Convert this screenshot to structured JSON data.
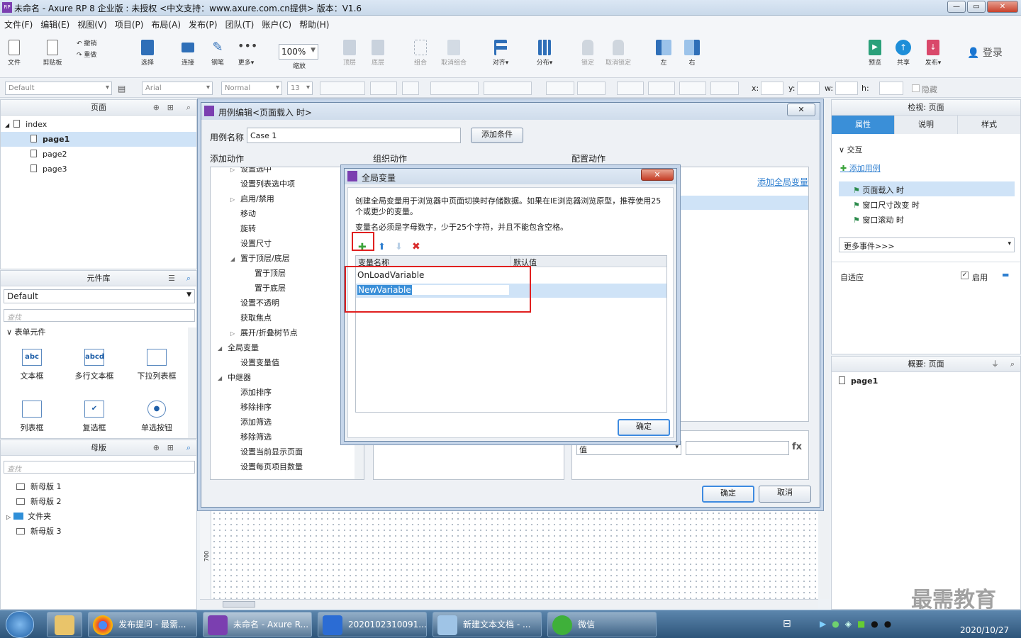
{
  "window": {
    "title": "未命名 - Axure RP 8 企业版 : 未授权     <中文支持：www.axure.com.cn提供> 版本：V1.6",
    "app_icon": "RP"
  },
  "menu": [
    "文件(F)",
    "编辑(E)",
    "视图(V)",
    "项目(P)",
    "布局(A)",
    "发布(P)",
    "团队(T)",
    "账户(C)",
    "帮助(H)"
  ],
  "toolbar": {
    "file": "文件",
    "clipboard": "剪贴板",
    "undo": "撤销",
    "redo": "重做",
    "select": "选择",
    "connect": "连接",
    "pen": "钢笔",
    "more": "更多▾",
    "zoom_value": "100%",
    "zoom": "缩放",
    "top": "顶层",
    "bottom": "底层",
    "group": "组合",
    "ungroup": "取消组合",
    "align": "对齐▾",
    "distribute": "分布▾",
    "lock": "锁定",
    "unlock": "取消锁定",
    "left": "左",
    "right": "右",
    "preview": "预览",
    "share": "共享",
    "publish": "发布▾",
    "login": "登录"
  },
  "format": {
    "style": "Default",
    "font": "Arial",
    "weight": "Normal",
    "size": "13",
    "x": "x:",
    "y": "y:",
    "w": "w:",
    "h": "h:",
    "hide": "隐藏"
  },
  "pages_panel": {
    "title": "页面",
    "root": "index",
    "pages": [
      "page1",
      "page2",
      "page3"
    ]
  },
  "library_panel": {
    "title": "元件库",
    "library": "Default",
    "search": "查找",
    "section": "表单元件",
    "widgets": [
      {
        "label": "文本框",
        "icon": "abc"
      },
      {
        "label": "多行文本框",
        "icon": "abcd"
      },
      {
        "label": "下拉列表框",
        "icon": ""
      },
      {
        "label": "列表框",
        "icon": ""
      },
      {
        "label": "复选框",
        "icon": "✔"
      },
      {
        "label": "单选按钮",
        "icon": "●"
      }
    ]
  },
  "masters_panel": {
    "title": "母版",
    "search": "查找",
    "items": [
      "新母版 1",
      "新母版 2",
      "文件夹",
      "新母版 3"
    ]
  },
  "case_editor": {
    "title": "用例编辑<页面载入 时>",
    "case_name_label": "用例名称",
    "case_name_value": "Case 1",
    "add_condition": "添加条件",
    "col_add": "添加动作",
    "col_organize": "组织动作",
    "col_configure": "配置动作",
    "add_global_var": "添加全局变量",
    "actions": [
      {
        "label": "设置选中",
        "indent": 2,
        "arrow": "▷"
      },
      {
        "label": "设置列表选中项",
        "indent": 2,
        "arrow": ""
      },
      {
        "label": "启用/禁用",
        "indent": 2,
        "arrow": "▷"
      },
      {
        "label": "移动",
        "indent": 2,
        "arrow": ""
      },
      {
        "label": "旋转",
        "indent": 2,
        "arrow": ""
      },
      {
        "label": "设置尺寸",
        "indent": 2,
        "arrow": ""
      },
      {
        "label": "置于顶层/底层",
        "indent": 2,
        "arrow": "◢"
      },
      {
        "label": "置于顶层",
        "indent": 3,
        "arrow": ""
      },
      {
        "label": "置于底层",
        "indent": 3,
        "arrow": ""
      },
      {
        "label": "设置不透明",
        "indent": 2,
        "arrow": ""
      },
      {
        "label": "获取焦点",
        "indent": 2,
        "arrow": ""
      },
      {
        "label": "展开/折叠树节点",
        "indent": 2,
        "arrow": "▷"
      },
      {
        "label": "全局变量",
        "indent": 1,
        "arrow": "◢"
      },
      {
        "label": "设置变量值",
        "indent": 2,
        "arrow": ""
      },
      {
        "label": "中继器",
        "indent": 1,
        "arrow": "◢"
      },
      {
        "label": "添加排序",
        "indent": 2,
        "arrow": ""
      },
      {
        "label": "移除排序",
        "indent": 2,
        "arrow": ""
      },
      {
        "label": "添加筛选",
        "indent": 2,
        "arrow": ""
      },
      {
        "label": "移除筛选",
        "indent": 2,
        "arrow": ""
      },
      {
        "label": "设置当前显示页面",
        "indent": 2,
        "arrow": ""
      },
      {
        "label": "设置每页项目数量",
        "indent": 2,
        "arrow": ""
      }
    ],
    "value_dropdown": "值",
    "fx": "fx",
    "ok": "确定",
    "cancel": "取消"
  },
  "global_vars": {
    "title": "全局变量",
    "desc1": "创建全局变量用于浏览器中页面切换时存储数据。如果在IE浏览器浏览原型，推荐使用25个或更少的变量。",
    "desc2": "变量名必须是字母数字，少于25个字符，并且不能包含空格。",
    "col_name": "变量名称",
    "col_default": "默认值",
    "rows": [
      "OnLoadVariable",
      "NewVariable"
    ],
    "ok": "确定"
  },
  "inspector": {
    "title": "检视: 页面",
    "tabs": [
      "属性",
      "说明",
      "样式"
    ],
    "interaction": "交互",
    "add_case": "添加用例",
    "events": [
      "页面载入 时",
      "窗口尺寸改变 时",
      "窗口滚动 时"
    ],
    "more_events": "更多事件>>>",
    "adaptive": "自适应",
    "enable": "启用"
  },
  "outline": {
    "title": "概要: 页面",
    "item": "page1"
  },
  "canvas": {
    "ruler_mark": "700"
  },
  "watermark": "最需教育",
  "taskbar": {
    "tasks": [
      "发布提问 - 最需...",
      "未命名 - Axure R...",
      "2020102310091...",
      "新建文本文档 - ...",
      "微信"
    ],
    "date": "2020/10/27"
  },
  "colors": {
    "accent": "#3a8fd8",
    "tab_active": "#3a8fd8",
    "highlight": "#cfe3f7",
    "red": "#e02020"
  }
}
